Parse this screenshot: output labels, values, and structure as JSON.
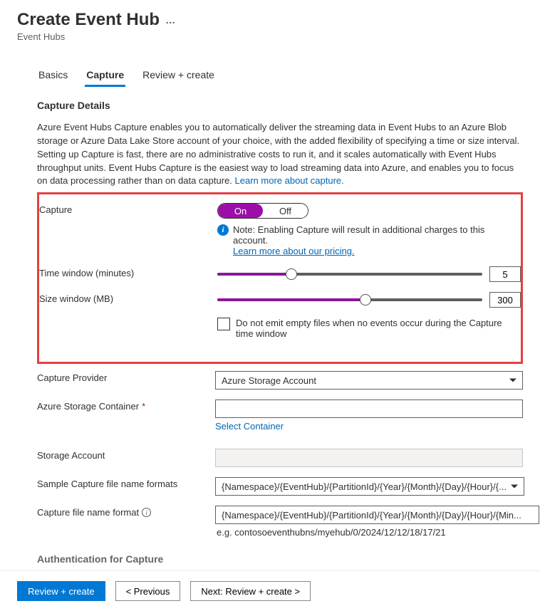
{
  "header": {
    "title": "Create Event Hub",
    "more": "…",
    "breadcrumb": "Event Hubs"
  },
  "tabs": [
    {
      "label": "Basics",
      "active": false
    },
    {
      "label": "Capture",
      "active": true
    },
    {
      "label": "Review + create",
      "active": false
    }
  ],
  "capture_details": {
    "title": "Capture Details",
    "description": "Azure Event Hubs Capture enables you to automatically deliver the streaming data in Event Hubs to an Azure Blob storage or Azure Data Lake Store account of your choice, with the added flexibility of specifying a time or size interval. Setting up Capture is fast, there are no administrative costs to run it, and it scales automatically with Event Hubs throughput units. Event Hubs Capture is the easiest way to load streaming data into Azure, and enables you to focus on data processing rather than on data capture. ",
    "learn_more": "Learn more about capture."
  },
  "form": {
    "capture_label": "Capture",
    "toggle": {
      "on": "On",
      "off": "Off",
      "value": "On"
    },
    "note": "Note: Enabling Capture will result in additional charges to this account.",
    "pricing_link": "Learn more about our pricing.",
    "time_window_label": "Time window (minutes)",
    "time_window_value": "5",
    "time_slider_pct": 28,
    "size_window_label": "Size window (MB)",
    "size_window_value": "300",
    "size_slider_pct": 56,
    "empty_files_label": "Do not emit empty files when no events occur during the Capture time window",
    "provider_label": "Capture Provider",
    "provider_value": "Azure Storage Account",
    "container_label": "Azure Storage Container",
    "container_required": "*",
    "container_value": "",
    "select_container": "Select Container",
    "storage_account_label": "Storage Account",
    "storage_account_value": "",
    "sample_formats_label": "Sample Capture file name formats",
    "sample_formats_value": "{Namespace}/{EventHub}/{PartitionId}/{Year}/{Month}/{Day}/{Hour}/{...",
    "filename_format_label": "Capture file name format",
    "filename_format_value": "{Namespace}/{EventHub}/{PartitionId}/{Year}/{Month}/{Day}/{Hour}/{Min...",
    "filename_example": "e.g. contosoeventhubns/myehub/0/2024/12/12/18/17/21"
  },
  "next_section": "Authentication for Capture",
  "footer": {
    "review": "Review + create",
    "previous": "< Previous",
    "next": "Next: Review + create >"
  }
}
